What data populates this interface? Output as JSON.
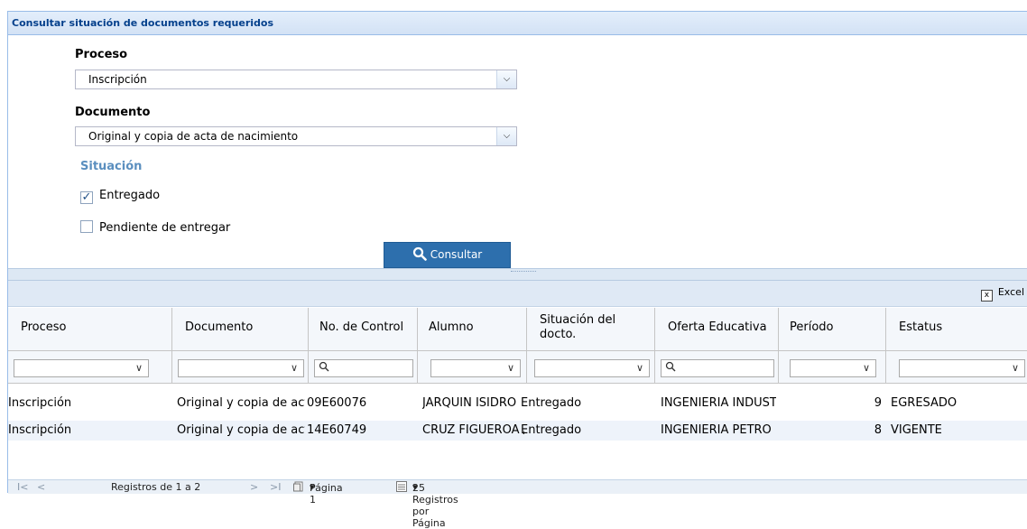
{
  "panel": {
    "title": "Consultar situación de documentos requeridos"
  },
  "form": {
    "proceso_label": "Proceso",
    "proceso_value": "Inscripción",
    "documento_label": "Documento",
    "documento_value": "Original y copia de acta de nacimiento",
    "situacion_label": "Situación",
    "chk_entregado_label": "Entregado",
    "chk_entregado_checked": true,
    "chk_pendiente_label": "Pendiente de entregar",
    "chk_pendiente_checked": false,
    "consultar_label": "Consultar"
  },
  "toolbar": {
    "excel_label": "Excel"
  },
  "grid": {
    "columns": [
      "Proceso",
      "Documento",
      "No. de Control",
      "Alumno",
      "Situación del docto.",
      "Oferta Educativa",
      "Período",
      "Estatus"
    ],
    "rows": [
      {
        "proceso": "Inscripción",
        "documento": "Original y copia de act",
        "control": "09E60076",
        "alumno": "JARQUIN ISIDRO",
        "situacion": "Entregado",
        "oferta": "INGENIERIA INDUST",
        "periodo": "9",
        "estatus": "EGRESADO"
      },
      {
        "proceso": "Inscripción",
        "documento": "Original y copia de act",
        "control": "14E60749",
        "alumno": "CRUZ FIGUEROA /",
        "situacion": "Entregado",
        "oferta": "INGENIERIA PETRO",
        "periodo": "8",
        "estatus": "VIGENTE"
      }
    ]
  },
  "pager": {
    "first": "I<",
    "prev": "<",
    "range": "Registros de 1 a 2",
    "next": ">",
    "last": ">I",
    "page": "Página 1",
    "per_page": "25 Registros por Página"
  },
  "colors": {
    "primary_button": "#2d6fad",
    "header_text": "#04408c",
    "section_label": "#5b8fbf"
  }
}
